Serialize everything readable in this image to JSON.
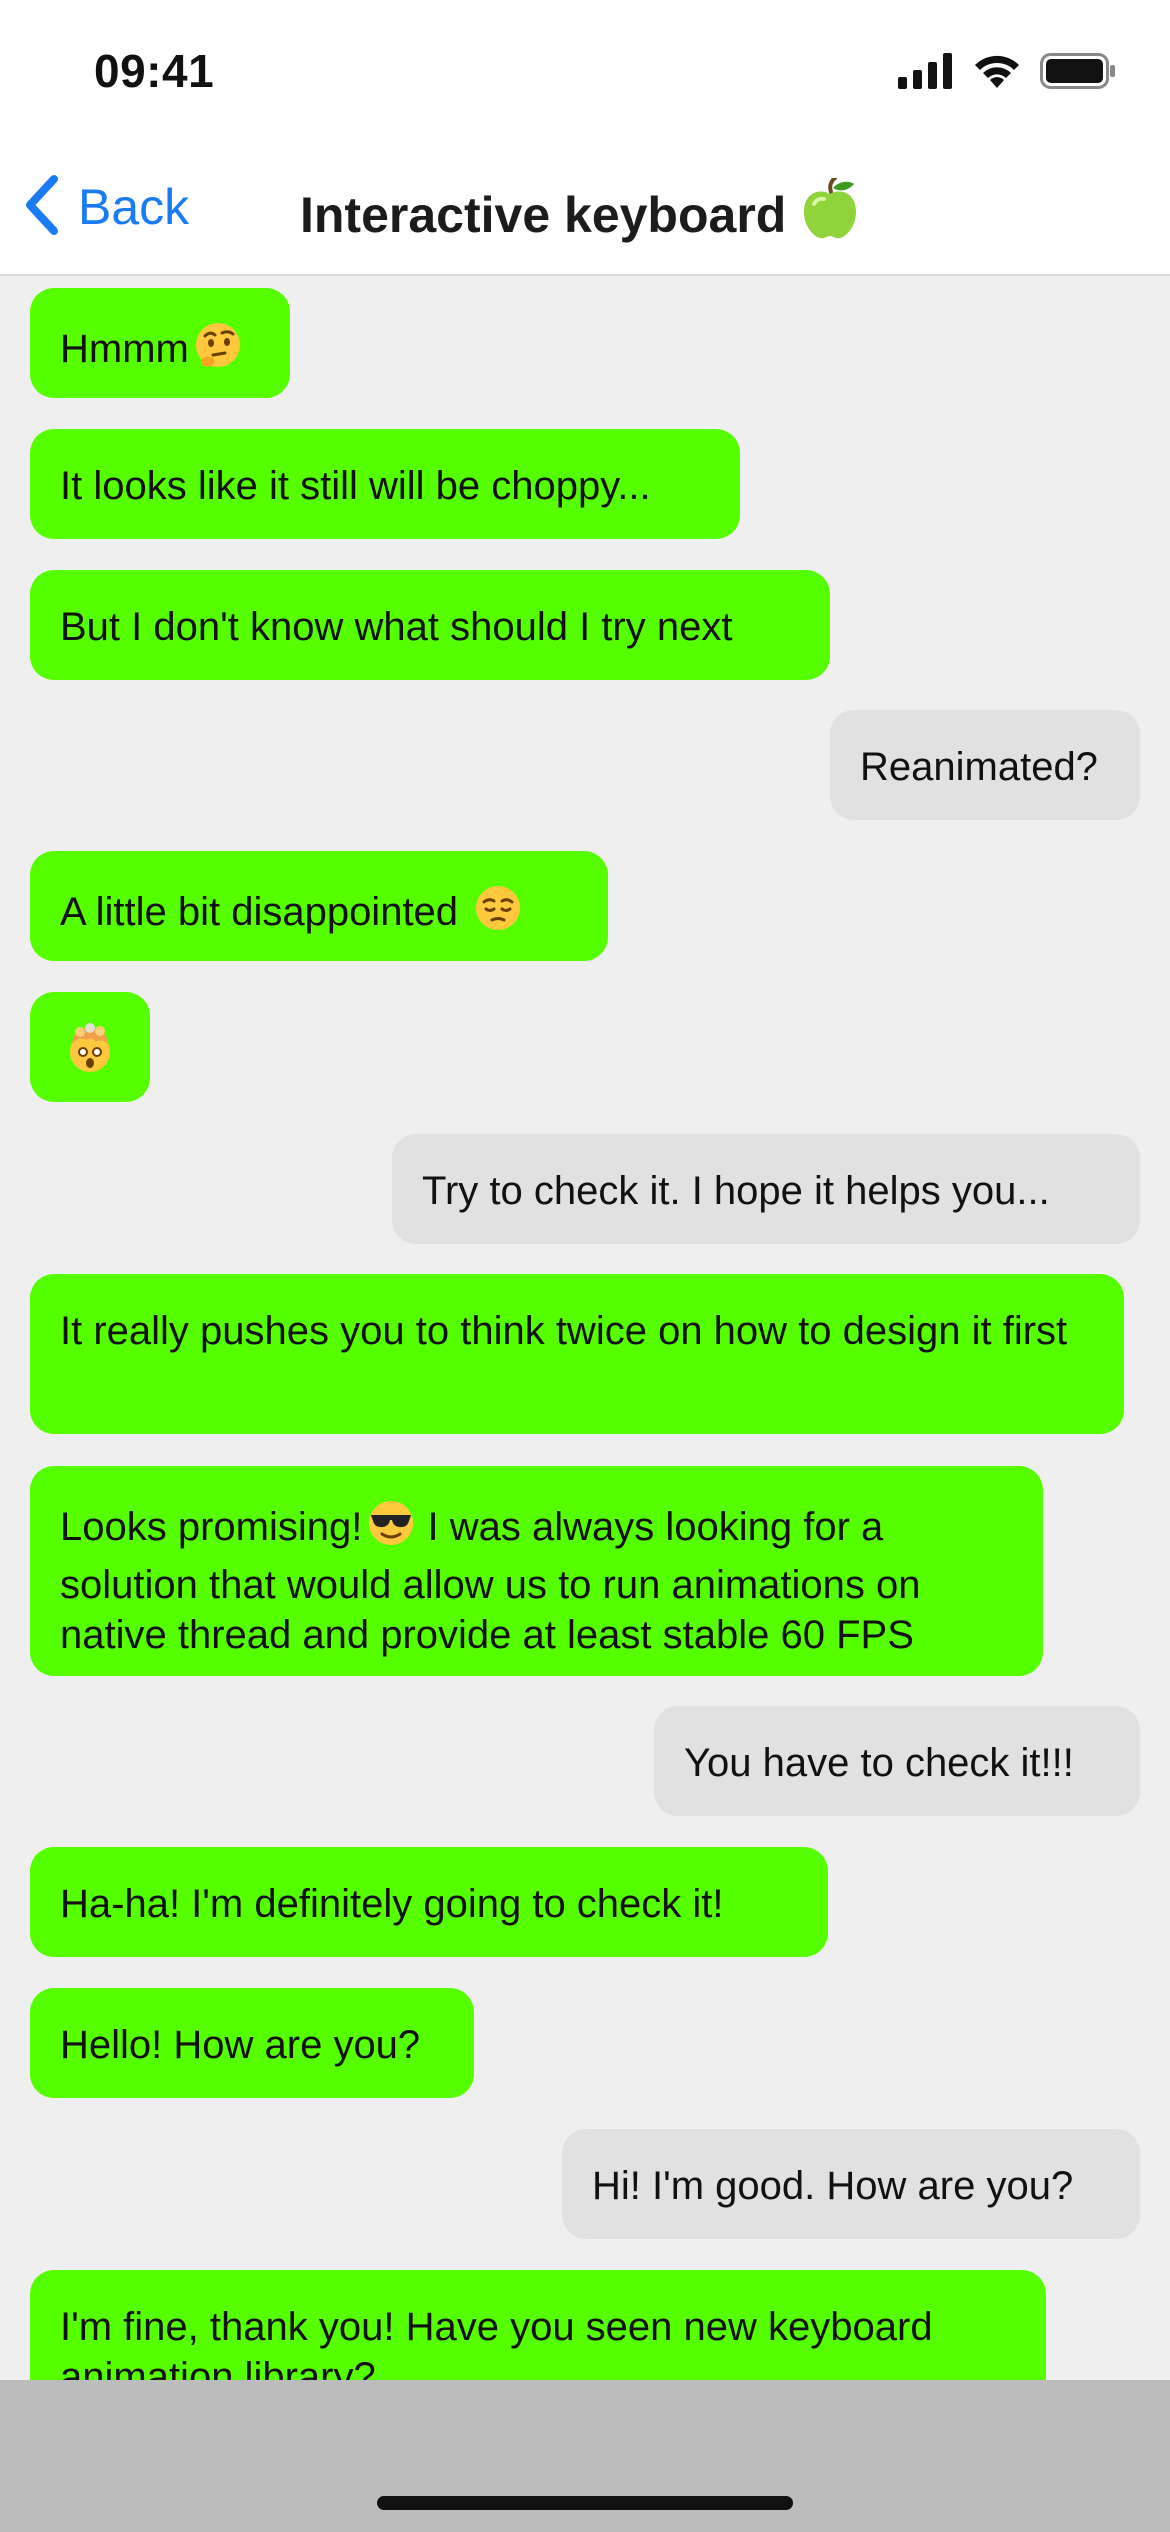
{
  "status_bar": {
    "time": "09:41",
    "icons": [
      "signal-icon",
      "wifi-icon",
      "battery-icon"
    ]
  },
  "nav": {
    "back_label": "Back",
    "title": "Interactive keyboard",
    "title_icon": "green-apple-icon"
  },
  "colors": {
    "incoming_bubble": "#56ff00",
    "outgoing_bubble": "#e1e1e1",
    "accent": "#1a7cf5",
    "bottom_area": "#bcbcbc"
  },
  "messages": [
    {
      "direction": "incoming",
      "text": "Hmmm",
      "emoji": "thinking-face-icon"
    },
    {
      "direction": "incoming",
      "text": "It looks like it still will be choppy..."
    },
    {
      "direction": "incoming",
      "text": "But I don't know what should I try next"
    },
    {
      "direction": "outgoing",
      "text": "Reanimated?"
    },
    {
      "direction": "incoming",
      "text": "A little bit disappointed",
      "emoji": "pensive-face-icon"
    },
    {
      "direction": "incoming",
      "text": "",
      "emoji": "exploding-head-icon"
    },
    {
      "direction": "outgoing",
      "text": "Try to check it. I hope it helps you..."
    },
    {
      "direction": "incoming",
      "text": "It really pushes you to think twice on how to design it first"
    },
    {
      "direction": "incoming",
      "text_before": "Looks promising!",
      "emoji": "sunglasses-face-icon",
      "text_after": " I was always looking for a solution that would allow us to run animations on native thread and provide at least stable 60 FPS"
    },
    {
      "direction": "outgoing",
      "text": "You have to check it!!!"
    },
    {
      "direction": "incoming",
      "text": "Ha-ha! I'm definitely going to check it!"
    },
    {
      "direction": "incoming",
      "text": "Hello! How are you?"
    },
    {
      "direction": "outgoing",
      "text": "Hi! I'm good. How are you?"
    },
    {
      "direction": "incoming",
      "text": "I'm fine, thank you! Have you seen new keyboard animation library?"
    }
  ]
}
